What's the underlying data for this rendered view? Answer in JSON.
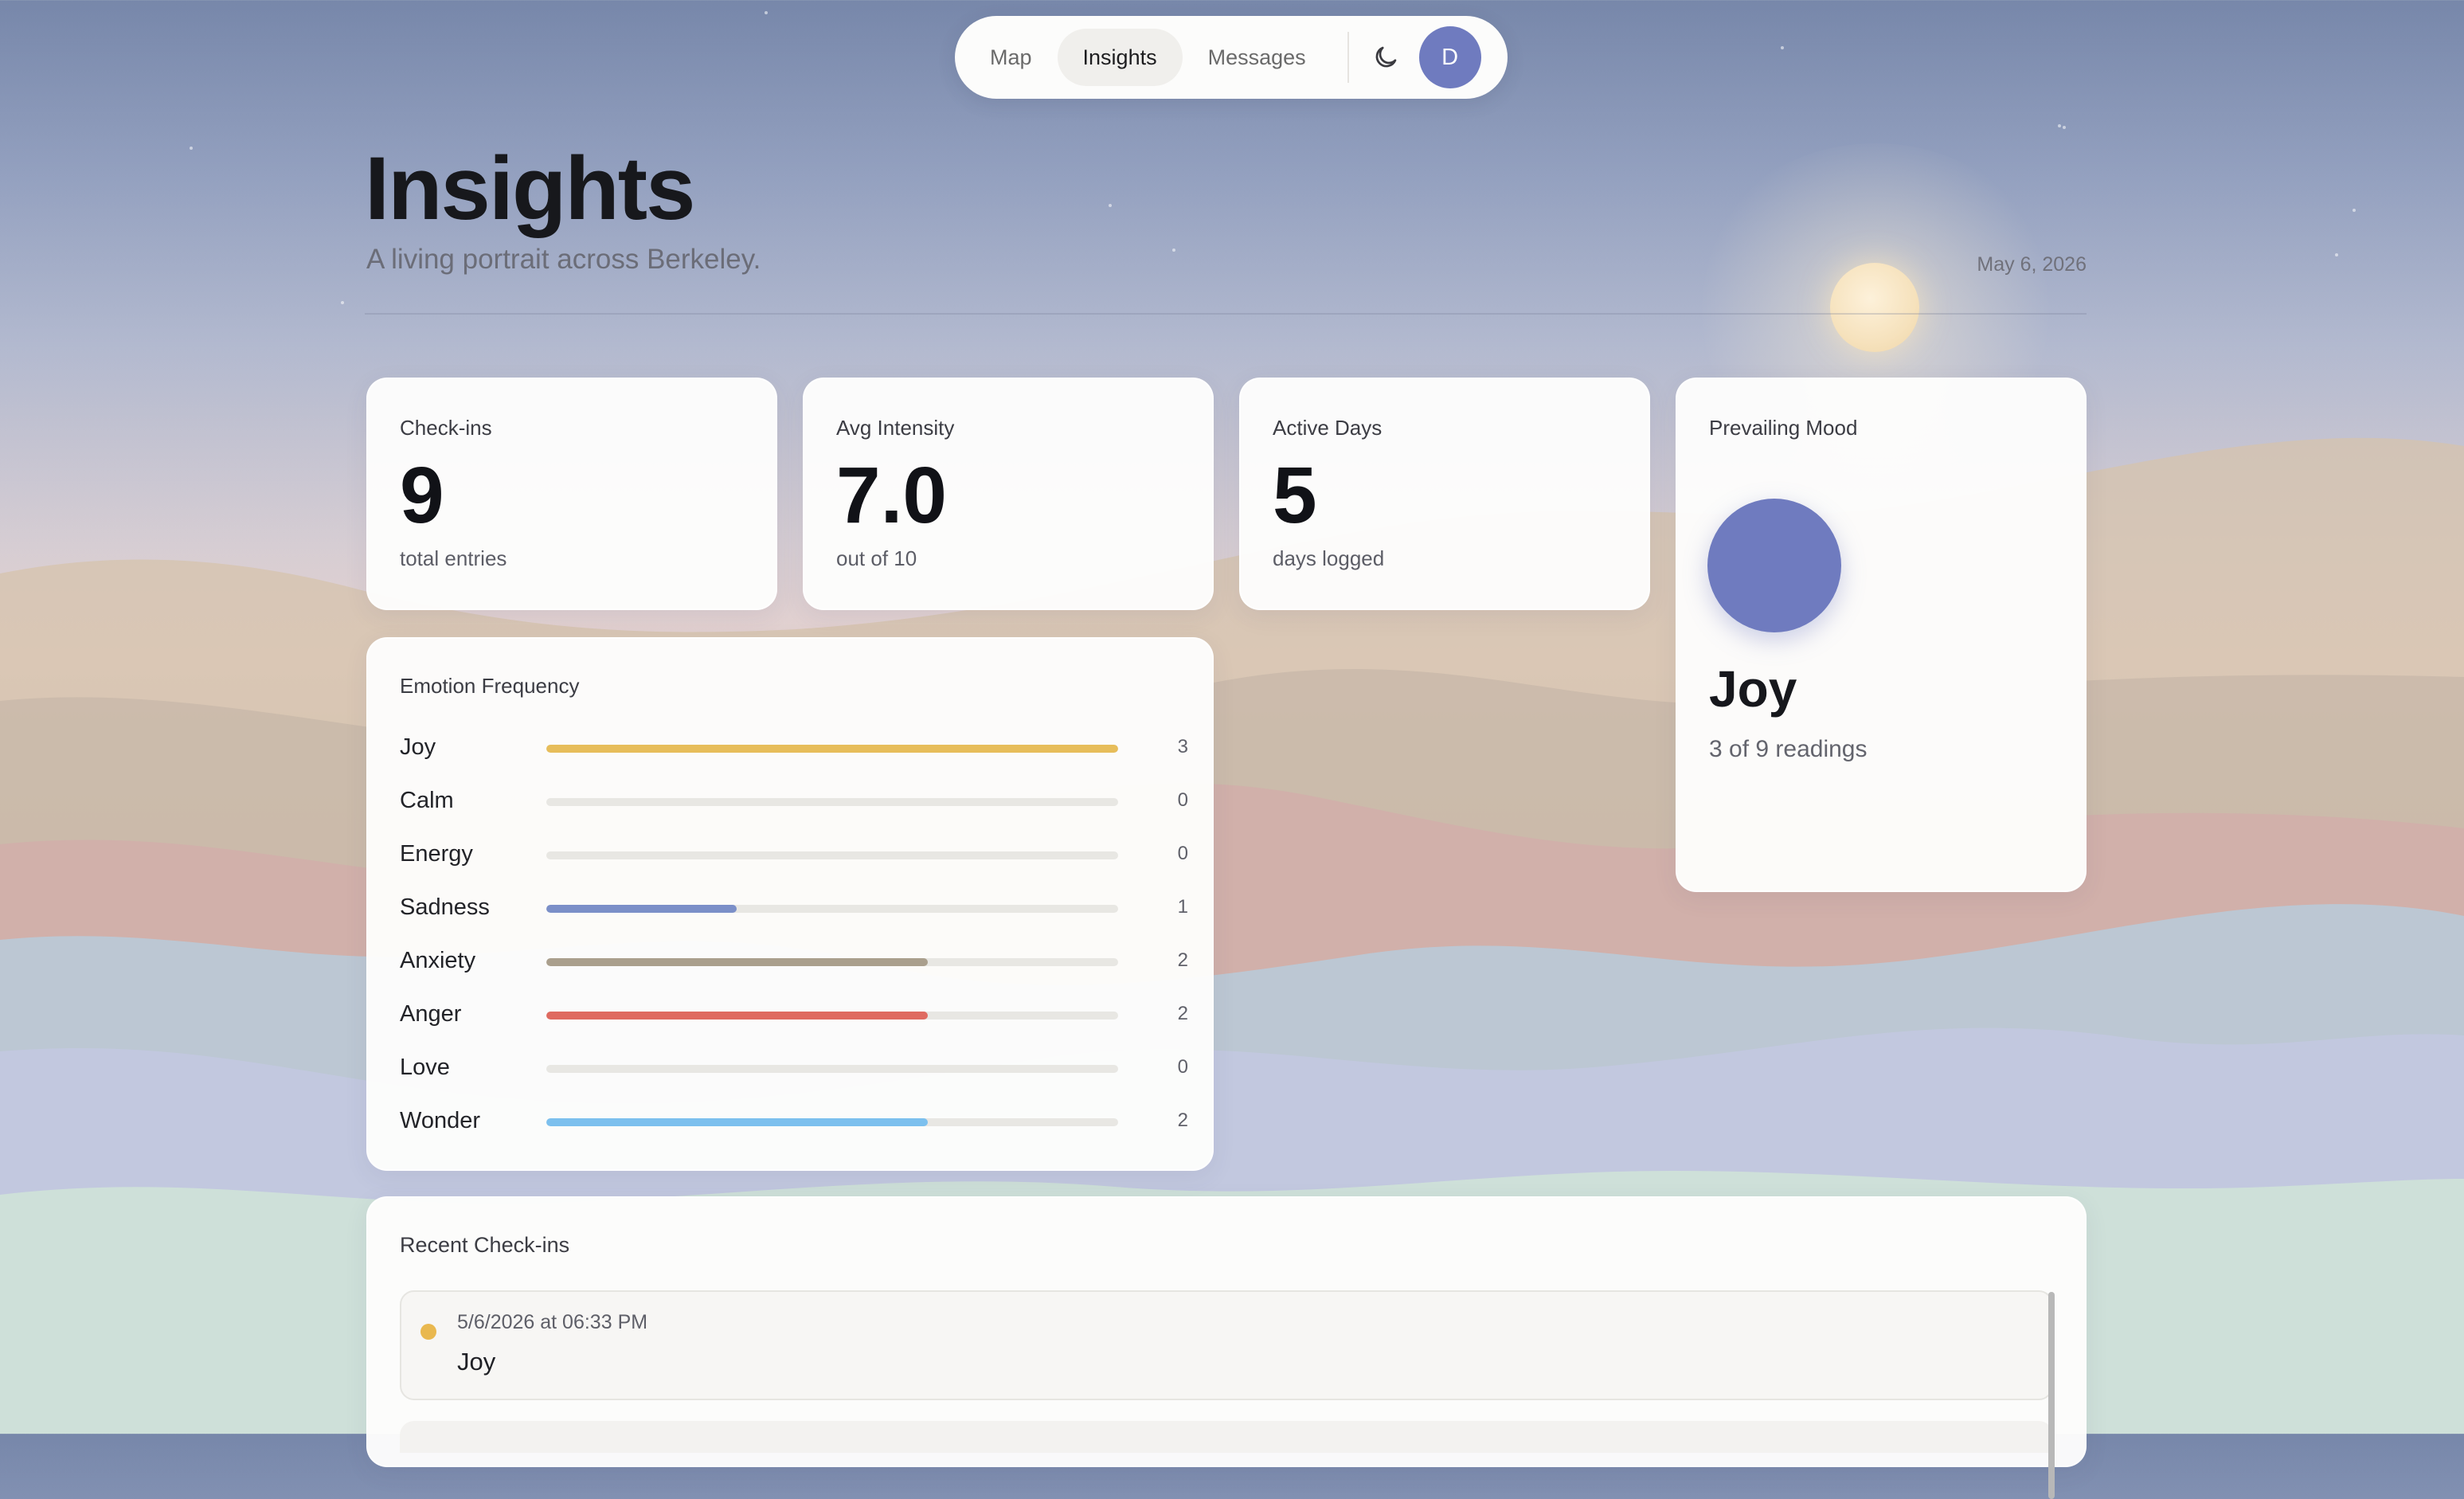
{
  "nav": {
    "tabs": [
      {
        "label": "Map",
        "active": false
      },
      {
        "label": "Insights",
        "active": true
      },
      {
        "label": "Messages",
        "active": false
      }
    ],
    "theme_icon": "moon-icon",
    "avatar_initial": "D",
    "avatar_color": "#6f7bbf"
  },
  "header": {
    "title": "Insights",
    "subtitle": "A living portrait across Berkeley.",
    "date": "May 6, 2026"
  },
  "stats": [
    {
      "label": "Check-ins",
      "value": "9",
      "sub": "total entries"
    },
    {
      "label": "Avg Intensity",
      "value": "7.0",
      "sub": "out of 10"
    },
    {
      "label": "Active Days",
      "value": "5",
      "sub": "days logged"
    }
  ],
  "prevailing_mood": {
    "label": "Prevailing Mood",
    "mood": "Joy",
    "sub": "3 of 9 readings",
    "orb_color": "#6f7bbf"
  },
  "emotion_frequency": {
    "title": "Emotion Frequency",
    "max": 3,
    "items": [
      {
        "name": "Joy",
        "count": 3,
        "color": "#e7bd5a"
      },
      {
        "name": "Calm",
        "count": 0,
        "color": "#9fc7a7"
      },
      {
        "name": "Energy",
        "count": 0,
        "color": "#f0a860"
      },
      {
        "name": "Sadness",
        "count": 1,
        "color": "#7b8fc8"
      },
      {
        "name": "Anxiety",
        "count": 2,
        "color": "#aa9f8d"
      },
      {
        "name": "Anger",
        "count": 2,
        "color": "#df6a60"
      },
      {
        "name": "Love",
        "count": 0,
        "color": "#e79ab1"
      },
      {
        "name": "Wonder",
        "count": 2,
        "color": "#7cc0ee"
      }
    ]
  },
  "recent_checkins": {
    "title": "Recent Check-ins",
    "items": [
      {
        "time": "5/6/2026 at 06:33 PM",
        "emotion": "Joy",
        "color": "#e9b84f"
      }
    ]
  }
}
